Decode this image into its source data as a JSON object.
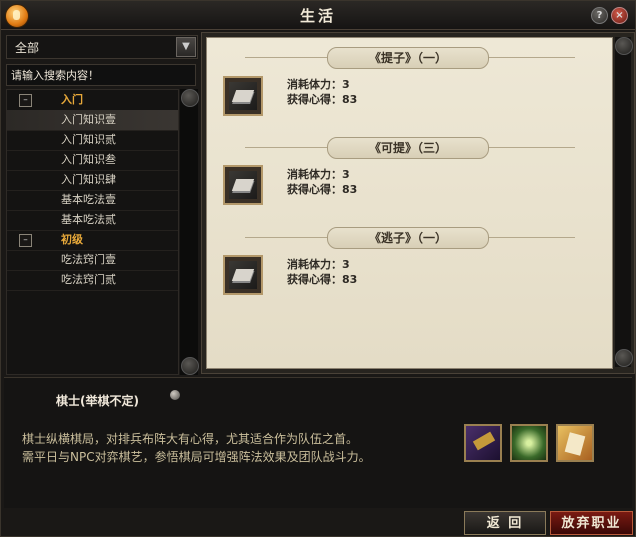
{
  "window": {
    "title": "生活"
  },
  "filter": {
    "selected": "全部",
    "search_placeholder": "请输入搜索内容！"
  },
  "tree": [
    {
      "type": "category",
      "label": "入门"
    },
    {
      "type": "item",
      "label": "入门知识壹",
      "selected": true
    },
    {
      "type": "item",
      "label": "入门知识贰"
    },
    {
      "type": "item",
      "label": "入门知识叁"
    },
    {
      "type": "item",
      "label": "入门知识肆"
    },
    {
      "type": "item",
      "label": "基本吃法壹"
    },
    {
      "type": "item",
      "label": "基本吃法贰"
    },
    {
      "type": "category",
      "label": "初级"
    },
    {
      "type": "item",
      "label": "吃法窍门壹"
    },
    {
      "type": "item",
      "label": "吃法窍门贰"
    }
  ],
  "recipes": [
    {
      "title": "《提子》（一）",
      "stamina_label": "消耗体力：",
      "stamina": "3",
      "exp_label": "获得心得：",
      "exp": "83"
    },
    {
      "title": "《可提》（三）",
      "stamina_label": "消耗体力：",
      "stamina": "3",
      "exp_label": "获得心得：",
      "exp": "83"
    },
    {
      "title": "《逃子》（一）",
      "stamina_label": "消耗体力：",
      "stamina": "3",
      "exp_label": "获得心得：",
      "exp": "83"
    }
  ],
  "profession": {
    "name": "棋士(举棋不定)",
    "desc_line1": "棋士纵横棋局，对排兵布阵大有心得，尤其适合作为队伍之首。",
    "desc_line2": "需平日与NPC对弈棋艺，参悟棋局可增强阵法效果及团队战斗力。"
  },
  "buttons": {
    "back": "返 回",
    "quit": "放弃职业"
  },
  "icons": {
    "skill1": "formation-skill-icon",
    "skill2": "aura-skill-icon",
    "skill3": "scroll-skill-icon"
  },
  "colors": {
    "category": "#e8a93a",
    "desc": "#cbbf9c",
    "paper": "#eee8d6"
  }
}
